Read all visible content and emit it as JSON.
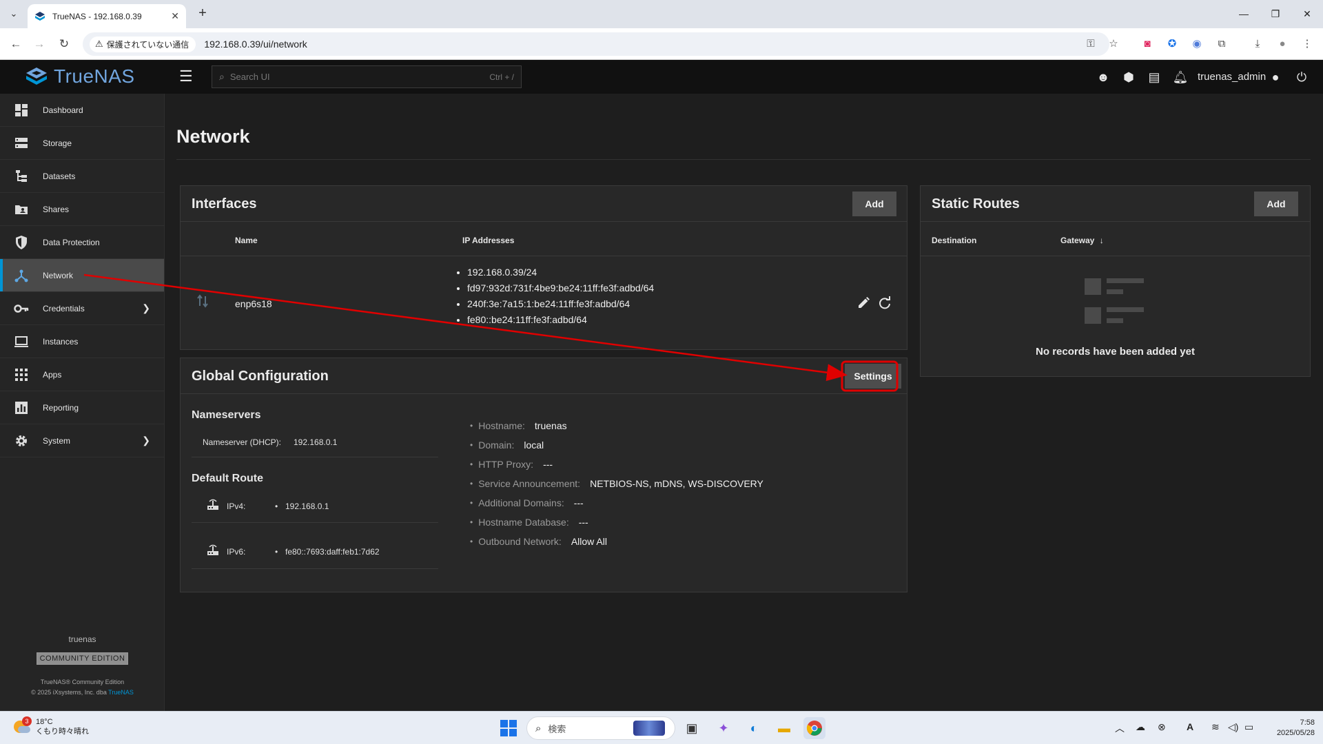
{
  "browser": {
    "tab_title": "TrueNAS - 192.168.0.39",
    "tab_close": "✕",
    "new_tab": "+",
    "security_label": "保護されていない通信",
    "url": "192.168.0.39/ui/network"
  },
  "header": {
    "brand": "TrueNAS",
    "search_placeholder": "Search UI",
    "search_shortcut": "Ctrl + /",
    "username": "truenas_admin"
  },
  "sidebar": {
    "items": [
      {
        "label": "Dashboard",
        "icon": "dashboard-icon"
      },
      {
        "label": "Storage",
        "icon": "storage-icon"
      },
      {
        "label": "Datasets",
        "icon": "datasets-icon"
      },
      {
        "label": "Shares",
        "icon": "shares-icon"
      },
      {
        "label": "Data Protection",
        "icon": "shield-icon"
      },
      {
        "label": "Network",
        "icon": "network-icon",
        "active": true
      },
      {
        "label": "Credentials",
        "icon": "key-icon",
        "expandable": true
      },
      {
        "label": "Instances",
        "icon": "laptop-icon"
      },
      {
        "label": "Apps",
        "icon": "apps-grid-icon"
      },
      {
        "label": "Reporting",
        "icon": "chart-icon"
      },
      {
        "label": "System",
        "icon": "gear-icon",
        "expandable": true
      }
    ],
    "footer": {
      "hostname": "truenas",
      "edition_badge": "COMMUNITY EDITION",
      "copyright_line1": "TrueNAS® Community Edition",
      "copyright_line2_prefix": "© 2025 iXsystems, Inc. dba ",
      "copyright_link": "TrueNAS"
    }
  },
  "page": {
    "title": "Network"
  },
  "interfaces": {
    "title": "Interfaces",
    "add_label": "Add",
    "columns": [
      "Name",
      "IP Addresses"
    ],
    "rows": [
      {
        "name": "enp6s18",
        "ips": [
          "192.168.0.39/24",
          "fd97:932d:731f:4be9:be24:11ff:fe3f:adbd/64",
          "240f:3e:7a15:1:be24:11ff:fe3f:adbd/64",
          "fe80::be24:11ff:fe3f:adbd/64"
        ]
      }
    ]
  },
  "static_routes": {
    "title": "Static Routes",
    "add_label": "Add",
    "columns": [
      "Destination",
      "Gateway"
    ],
    "sort_indicator": "↓",
    "empty_message": "No records have been added yet"
  },
  "global_config": {
    "title": "Global Configuration",
    "settings_label": "Settings",
    "nameservers_heading": "Nameservers",
    "nameserver_label": "Nameserver (DHCP):",
    "nameserver_value": "192.168.0.1",
    "default_route_heading": "Default Route",
    "ipv4_label": "IPv4:",
    "ipv4_value": "192.168.0.1",
    "ipv6_label": "IPv6:",
    "ipv6_value": "fe80::7693:daff:feb1:7d62",
    "settings_list": [
      {
        "key": "Hostname:",
        "value": "truenas"
      },
      {
        "key": "Domain:",
        "value": "local"
      },
      {
        "key": "HTTP Proxy:",
        "value": "---"
      },
      {
        "key": "Service Announcement:",
        "value": "NETBIOS-NS, mDNS, WS-DISCOVERY"
      },
      {
        "key": "Additional Domains:",
        "value": "---"
      },
      {
        "key": "Hostname Database:",
        "value": "---"
      },
      {
        "key": "Outbound Network:",
        "value": "Allow All"
      }
    ]
  },
  "taskbar": {
    "weather_badge": "3",
    "temperature": "18°C",
    "weather_desc": "くもり時々晴れ",
    "search_placeholder": "検索",
    "time": "7:58",
    "date": "2025/05/28"
  },
  "colors": {
    "accent": "#0095d5",
    "annotation": "#e00000",
    "brand": "#71a5de"
  }
}
